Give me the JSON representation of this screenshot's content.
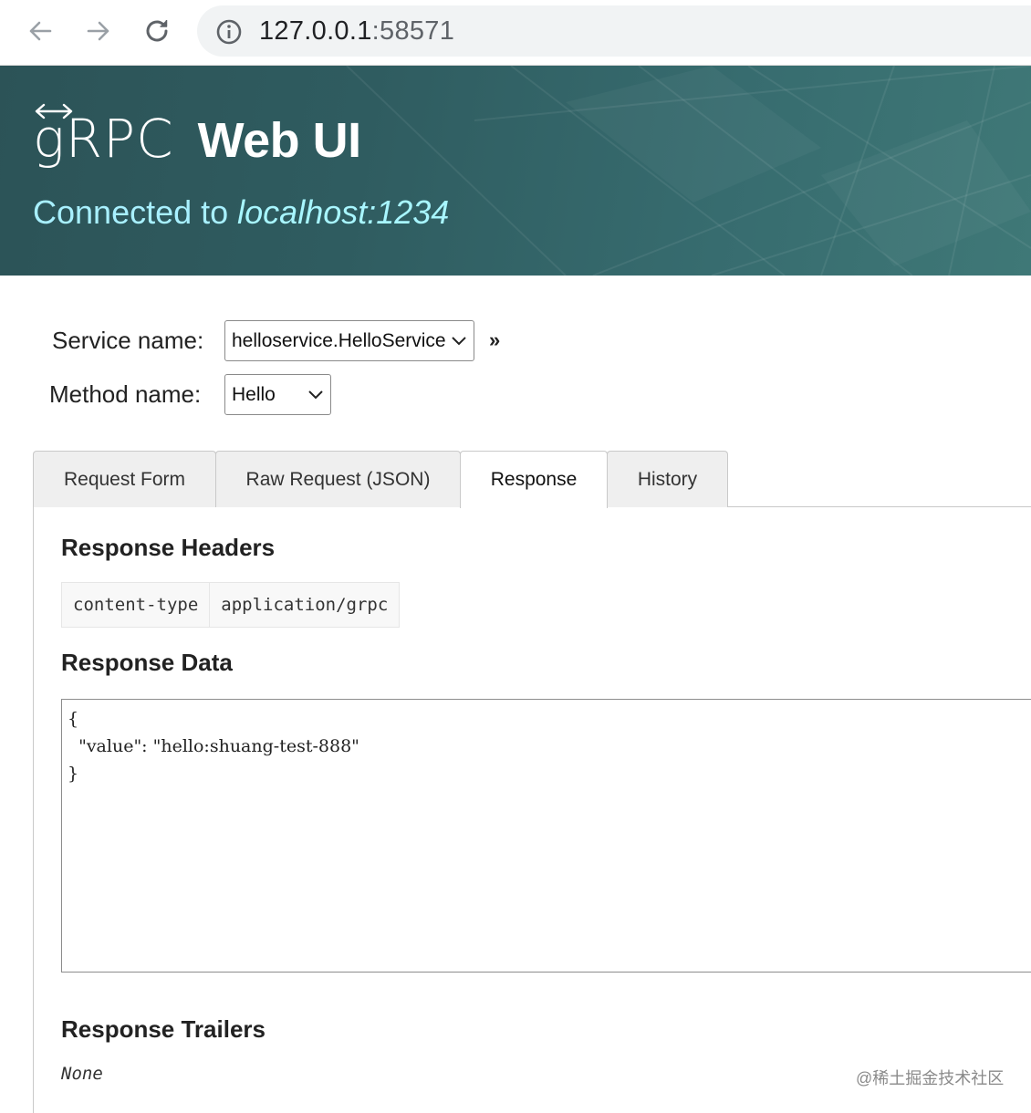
{
  "browser": {
    "url_host": "127.0.0.1",
    "url_port": ":58571",
    "back_icon": "arrow-left-icon",
    "forward_icon": "arrow-right-icon",
    "reload_icon": "reload-icon",
    "info_icon": "info-icon"
  },
  "header": {
    "logo_text": "gRPC",
    "title": "Web UI",
    "connected_prefix": "Connected to",
    "connected_host": "localhost:1234",
    "colors": {
      "background": "#2f5c60",
      "connected_text": "#a8f0ff"
    }
  },
  "form": {
    "service_label": "Service name:",
    "service_value": "helloservice.HelloService",
    "method_label": "Method name:",
    "method_value": "Hello",
    "go_label": "»"
  },
  "tabs": [
    {
      "label": "Request Form",
      "active": false
    },
    {
      "label": "Raw Request (JSON)",
      "active": false
    },
    {
      "label": "Response",
      "active": true
    },
    {
      "label": "History",
      "active": false
    }
  ],
  "response": {
    "headers_title": "Response Headers",
    "headers": [
      {
        "key": "content-type",
        "value": "application/grpc"
      }
    ],
    "data_title": "Response Data",
    "data_text": "{\n  \"value\": \"hello:shuang-test-888\"\n}",
    "trailers_title": "Response Trailers",
    "trailers_value": "None"
  },
  "watermark": "@稀土掘金技术社区"
}
